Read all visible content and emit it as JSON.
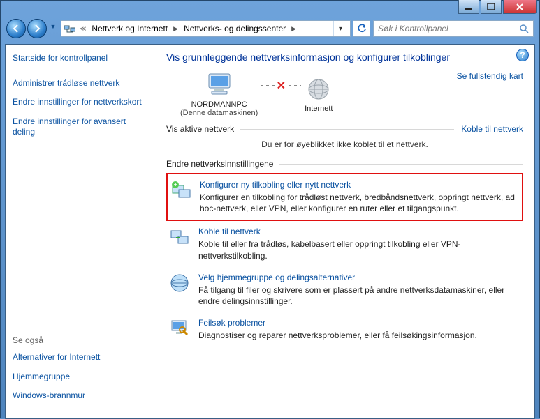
{
  "breadcrumb": {
    "item1": "Nettverk og Internett",
    "item2": "Nettverks- og delingssenter"
  },
  "search": {
    "placeholder": "Søk i Kontrollpanel"
  },
  "sidebar": {
    "home": "Startside for kontrollpanel",
    "links": {
      "wireless": "Administrer trådløse nettverk",
      "adapter": "Endre innstillinger for nettverkskort",
      "advanced": "Endre innstillinger for avansert deling"
    },
    "seealso_title": "Se også",
    "seealso": {
      "inetopt": "Alternativer for Internett",
      "homegroup": "Hjemmegruppe",
      "firewall": "Windows-brannmur"
    }
  },
  "main": {
    "heading": "Vis grunnleggende nettverksinformasjon og konfigurer tilkoblinger",
    "fullmap": "Se fullstendig kart",
    "map": {
      "pc": "NORDMANNPC",
      "pc_sub": "(Denne datamaskinen)",
      "internet": "Internett"
    },
    "active_title": "Vis aktive nettverk",
    "active_link": "Koble til nettverk",
    "active_none": "Du er for øyeblikket ikke koblet til et nettverk.",
    "change_title": "Endre nettverksinnstillingene",
    "tasks": {
      "new": {
        "title": "Konfigurer ny tilkobling eller nytt nettverk",
        "desc": "Konfigurer en tilkobling for trådløst nettverk, bredbåndsnettverk, oppringt nettverk, ad hoc-nettverk, eller VPN, eller konfigurer en ruter eller et tilgangspunkt."
      },
      "connect": {
        "title": "Koble til nettverk",
        "desc": "Koble til eller fra trådløs, kabelbasert eller oppringt tilkobling eller VPN-nettverkstilkobling."
      },
      "home": {
        "title": "Velg hjemmegruppe og delingsalternativer",
        "desc": "Få tilgang til filer og skrivere som er plassert på andre nettverksdatamaskiner, eller endre delingsinnstillinger."
      },
      "trouble": {
        "title": "Feilsøk problemer",
        "desc": "Diagnostiser og reparer nettverksproblemer, eller få feilsøkingsinformasjon."
      }
    }
  }
}
